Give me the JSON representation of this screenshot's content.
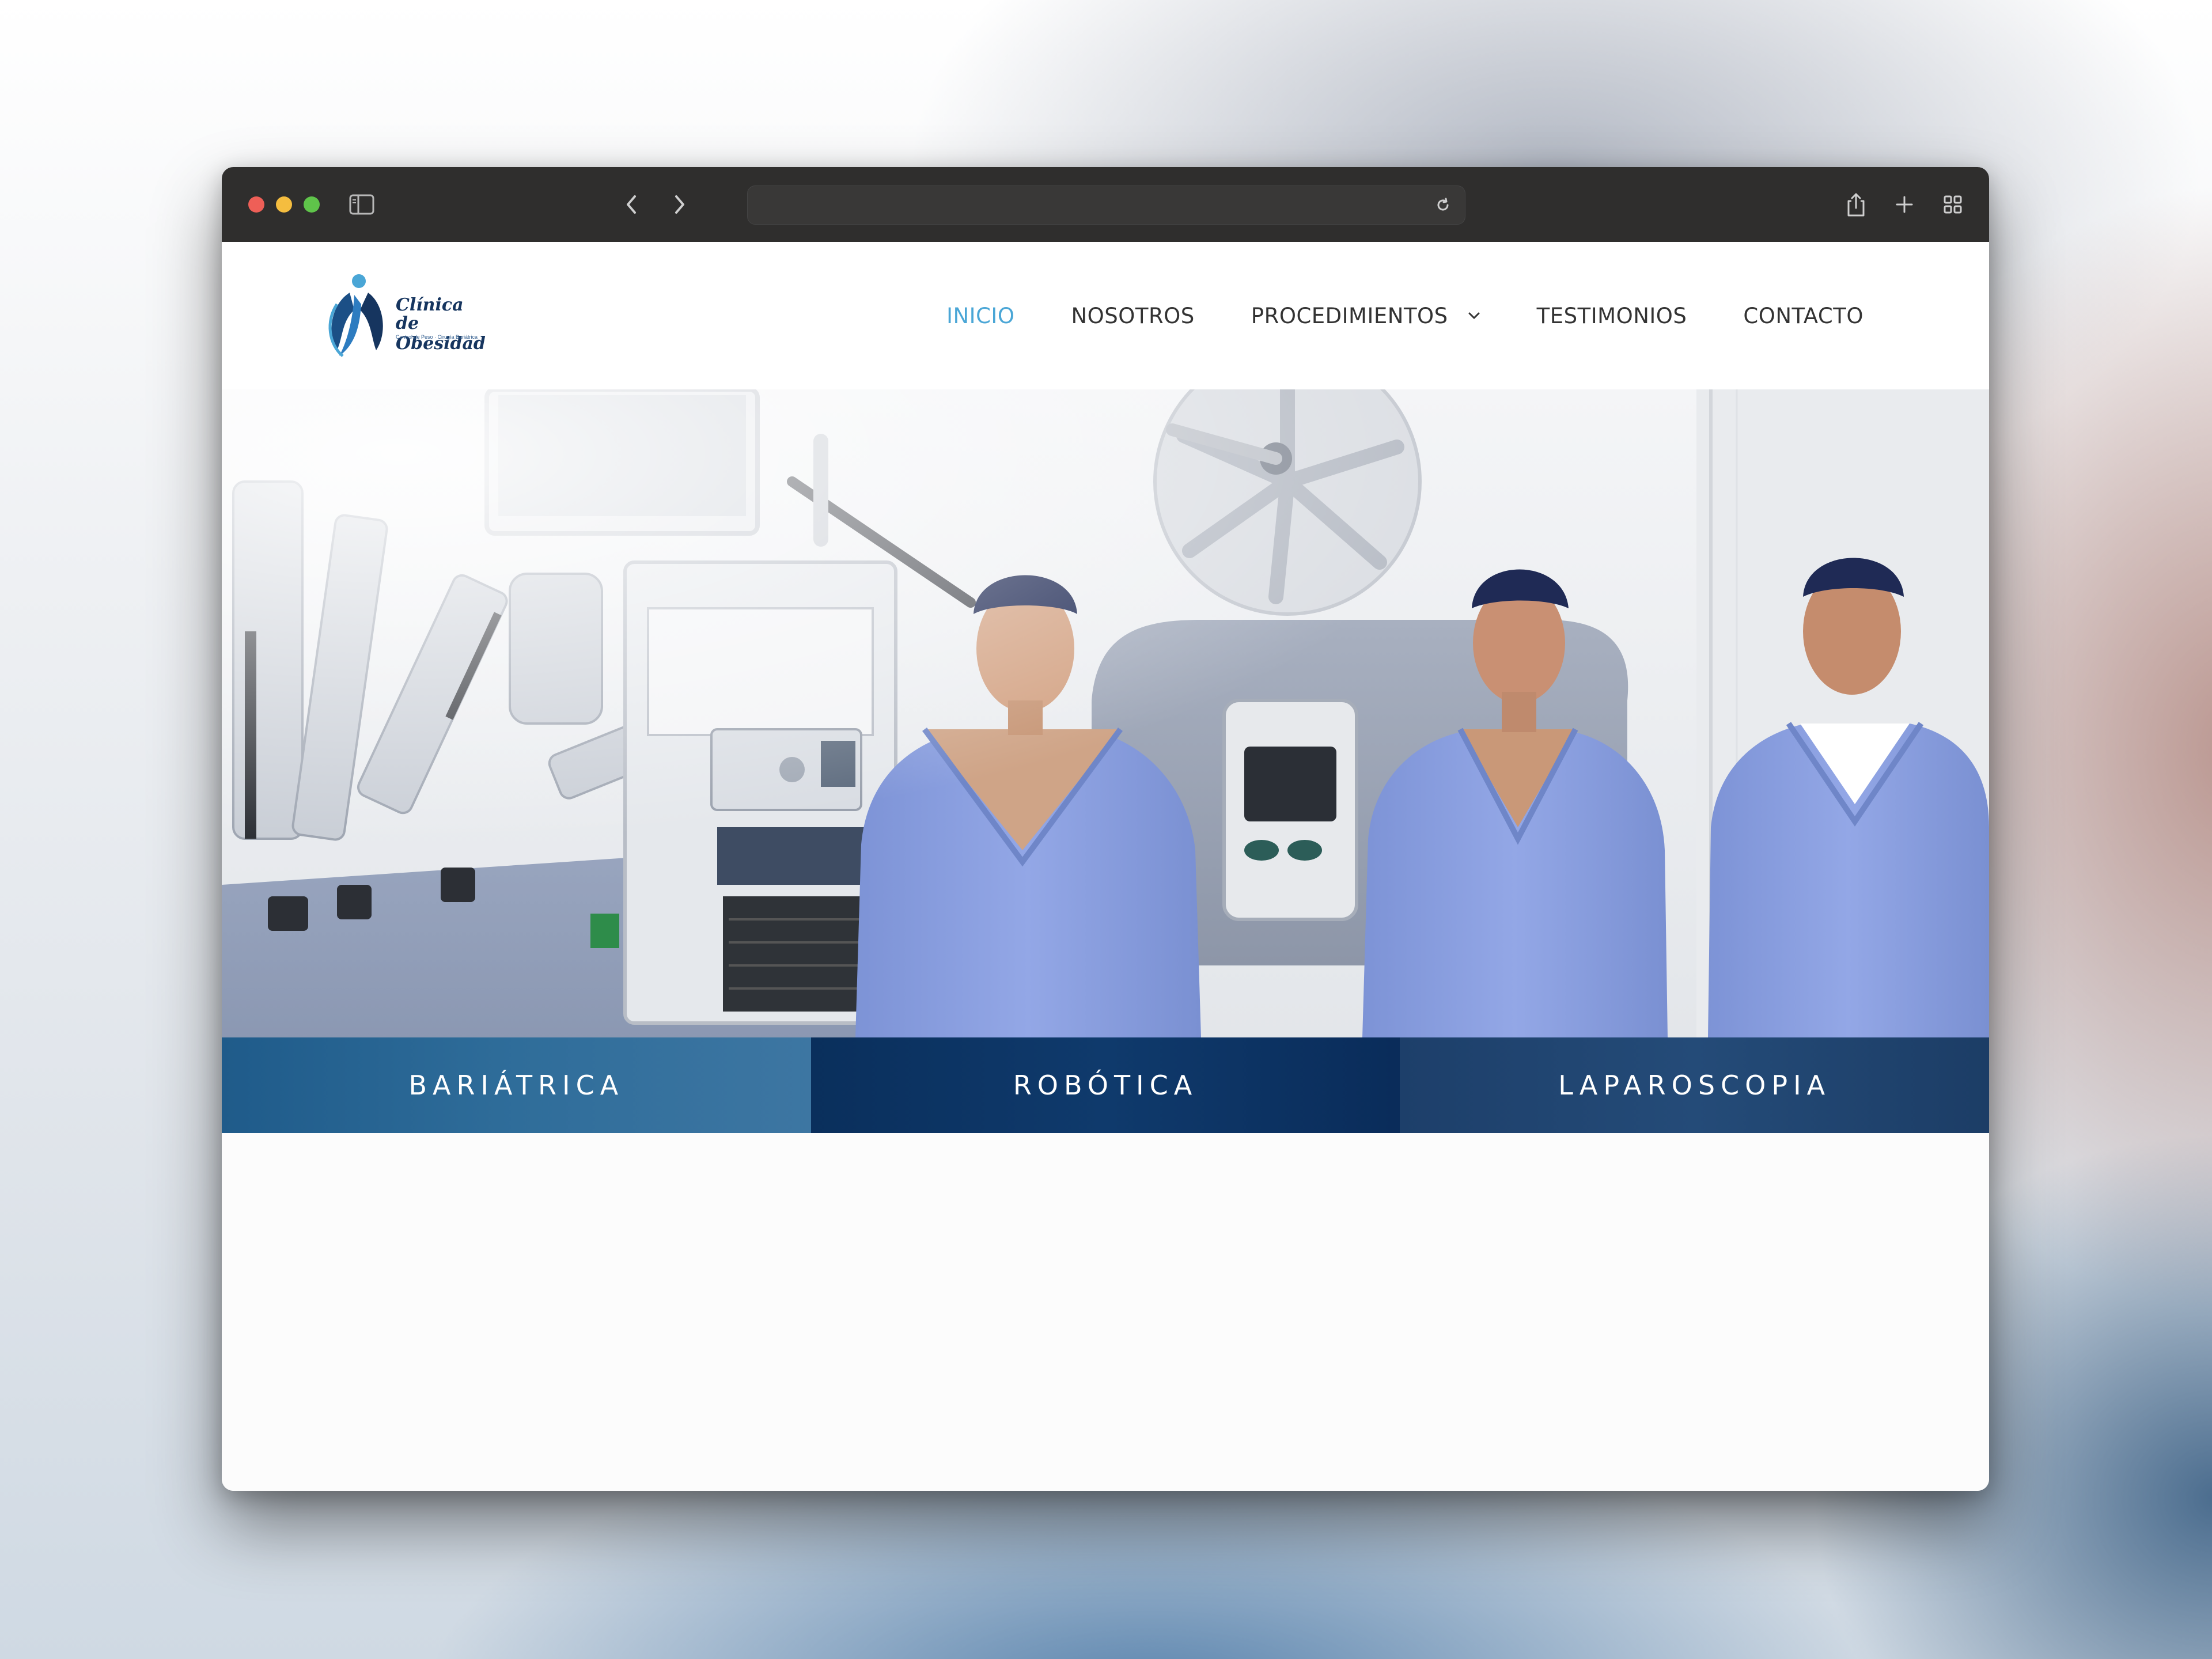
{
  "colors": {
    "nav_active": "#4aa6d6",
    "nav_text": "#333333",
    "brand_navy": "#16355f",
    "chrome_bg": "#2f2e2d",
    "category_1": "#2f6d9a",
    "category_2": "#0f3a6c",
    "category_3": "#244b78"
  },
  "browser": {
    "buttons": [
      "close",
      "minimize",
      "zoom"
    ],
    "icons": [
      "sidebar-icon",
      "back-icon",
      "forward-icon",
      "reload-icon",
      "share-icon",
      "plus-icon",
      "tabs-grid-icon"
    ],
    "url": ""
  },
  "site": {
    "logo": {
      "line1": "Clínica",
      "line2": "de Obesidad",
      "tagline": "Control de Peso · Cirugía Bariátrica"
    },
    "nav": {
      "items": [
        {
          "label": "INICIO",
          "active": true
        },
        {
          "label": "NOSOTROS",
          "active": false
        },
        {
          "label": "PROCEDIMIENTOS",
          "active": false,
          "has_dropdown": true
        },
        {
          "label": "TESTIMONIOS",
          "active": false
        },
        {
          "label": "CONTACTO",
          "active": false
        }
      ]
    },
    "hero": {
      "description_icon": "surgical-team-photo"
    },
    "categories": [
      {
        "label": "BARIÁTRICA"
      },
      {
        "label": "ROBÓTICA"
      },
      {
        "label": "LAPAROSCOPIA"
      }
    ]
  }
}
